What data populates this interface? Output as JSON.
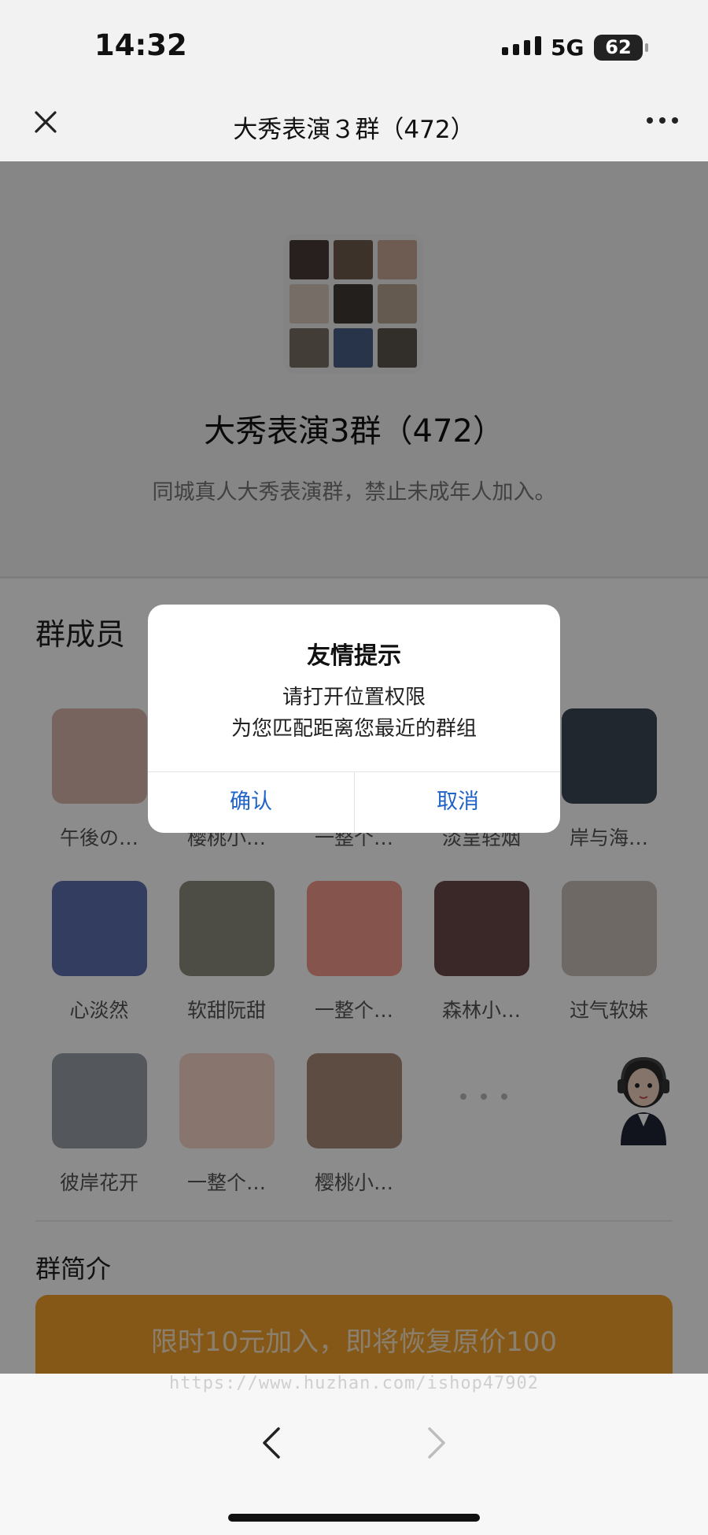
{
  "status_bar": {
    "time": "14:32",
    "network": "5G",
    "battery": "62"
  },
  "nav": {
    "title": "大秀表演３群（472）",
    "close_icon": "close-icon",
    "more_icon": "more-dots-icon"
  },
  "group": {
    "name": "大秀表演3群（472）",
    "description": "同城真人大秀表演群，禁止未成年人加入。"
  },
  "members": {
    "title": "群成员",
    "items": [
      {
        "name": "午後の…",
        "color": "#d9b7ae"
      },
      {
        "name": "樱桃小…",
        "color": "#c7a28a"
      },
      {
        "name": "一整个…",
        "color": "#e8b5a0"
      },
      {
        "name": "淡呈轻烟",
        "color": "#8a8a8a"
      },
      {
        "name": "岸与海…",
        "color": "#3b4756"
      },
      {
        "name": "心淡然",
        "color": "#5c6fae"
      },
      {
        "name": "软甜阮甜",
        "color": "#8c8a7e"
      },
      {
        "name": "一整个…",
        "color": "#f29a8a"
      },
      {
        "name": "森林小…",
        "color": "#6a4a4a"
      },
      {
        "name": "过气软妹",
        "color": "#c9c0b8"
      },
      {
        "name": "彼岸花开",
        "color": "#9aa0a8"
      },
      {
        "name": "一整个…",
        "color": "#f6d6c9"
      },
      {
        "name": "樱桃小…",
        "color": "#a88a78"
      }
    ]
  },
  "intro": {
    "title": "群简介"
  },
  "join_button": {
    "label": "限时10元加入，即将恢复原价100",
    "color": "#f2a02c"
  },
  "watermark": "https://www.huzhan.com/ishop47902",
  "dialog": {
    "title": "友情提示",
    "line1": "请打开位置权限",
    "line2": "为您匹配距离您最近的群组",
    "confirm": "确认",
    "cancel": "取消"
  }
}
